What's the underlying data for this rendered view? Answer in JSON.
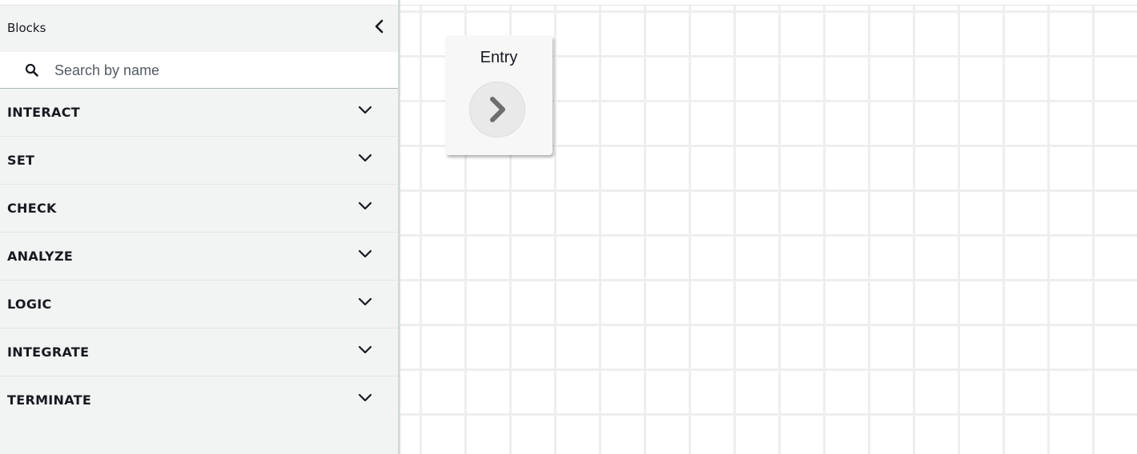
{
  "sidebar": {
    "title": "Blocks",
    "collapse_icon": "chevron-left-icon",
    "search": {
      "placeholder": "Search by name",
      "value": "",
      "icon": "search-icon"
    },
    "categories": [
      {
        "label": "INTERACT",
        "icon": "chevron-down-icon"
      },
      {
        "label": "SET",
        "icon": "chevron-down-icon"
      },
      {
        "label": "CHECK",
        "icon": "chevron-down-icon"
      },
      {
        "label": "ANALYZE",
        "icon": "chevron-down-icon"
      },
      {
        "label": "LOGIC",
        "icon": "chevron-down-icon"
      },
      {
        "label": "INTEGRATE",
        "icon": "chevron-down-icon"
      },
      {
        "label": "TERMINATE",
        "icon": "chevron-down-icon"
      }
    ]
  },
  "canvas": {
    "entry_block": {
      "title": "Entry",
      "port_icon": "chevron-right-icon"
    }
  },
  "colors": {
    "sidebar_bg": "#f2f3f3",
    "text": "#16191f",
    "grid": "#eeeeee",
    "chevron": "#545b64"
  }
}
